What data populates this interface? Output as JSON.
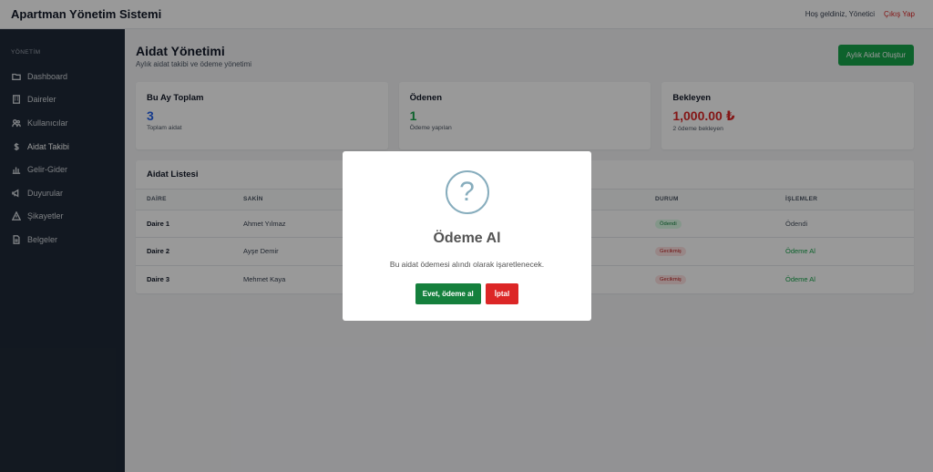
{
  "header": {
    "title": "Apartman Yönetim Sistemi",
    "welcome": "Hoş geldiniz, Yönetici",
    "logout": "Çıkış Yap"
  },
  "sidebar": {
    "section": "YÖNETİM",
    "items": [
      {
        "label": "Dashboard",
        "icon": "folder-icon"
      },
      {
        "label": "Daireler",
        "icon": "building-icon"
      },
      {
        "label": "Kullanıcılar",
        "icon": "users-icon"
      },
      {
        "label": "Aidat Takibi",
        "icon": "dollar-icon"
      },
      {
        "label": "Gelir-Gider",
        "icon": "chart-icon"
      },
      {
        "label": "Duyurular",
        "icon": "megaphone-icon"
      },
      {
        "label": "Şikayetler",
        "icon": "warning-icon"
      },
      {
        "label": "Belgeler",
        "icon": "document-icon"
      }
    ]
  },
  "page": {
    "title": "Aidat Yönetimi",
    "subtitle": "Aylık aidat takibi ve ödeme yönetimi",
    "create_button": "Aylık Aidat Oluştur"
  },
  "stats": [
    {
      "title": "Bu Ay Toplam",
      "value": "3",
      "sub": "Toplam aidat",
      "color": "#2563eb"
    },
    {
      "title": "Ödenen",
      "value": "1",
      "sub": "Ödeme yapılan",
      "color": "#16a34a"
    },
    {
      "title": "Bekleyen",
      "value": "1,000.00 ₺",
      "sub": "2 ödeme bekleyen",
      "color": "#dc2626"
    }
  ],
  "list": {
    "title": "Aidat Listesi",
    "columns": [
      "DAİRE",
      "SAKİN",
      "",
      "DURUM",
      "İŞLEMLER"
    ],
    "rows": [
      {
        "daire": "Daire 1",
        "sakin": "Ahmet Yılmaz",
        "durum": "Ödendi",
        "islem": "Ödendi"
      },
      {
        "daire": "Daire 2",
        "sakin": "Ayşe Demir",
        "durum": "Gecikmiş",
        "islem": "Ödeme Al"
      },
      {
        "daire": "Daire 3",
        "sakin": "Mehmet Kaya",
        "durum": "Gecikmiş",
        "islem": "Ödeme Al"
      }
    ]
  },
  "modal": {
    "icon": "question-icon",
    "icon_text": "?",
    "title": "Ödeme Al",
    "text": "Bu aidat ödemesi alındı olarak işaretlenecek.",
    "confirm": "Evet, ödeme al",
    "cancel": "İptal"
  }
}
